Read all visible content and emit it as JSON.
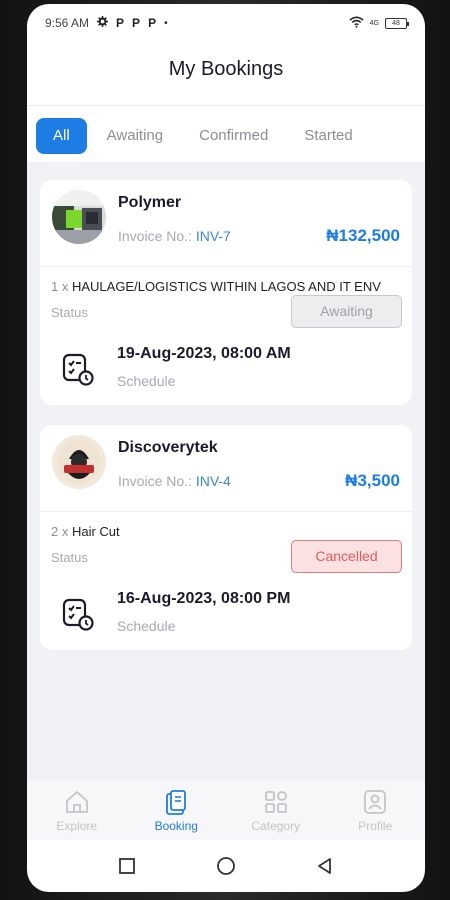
{
  "status_bar": {
    "time": "9:56 AM",
    "indicators": [
      "P",
      "P",
      "P"
    ],
    "dot": "•",
    "network": "4G",
    "battery": "48"
  },
  "header": {
    "title": "My Bookings"
  },
  "tabs": [
    {
      "label": "All",
      "active": true
    },
    {
      "label": "Awaiting",
      "active": false
    },
    {
      "label": "Confirmed",
      "active": false
    },
    {
      "label": "Started",
      "active": false
    }
  ],
  "bookings": [
    {
      "provider": "Polymer",
      "invoice_label": "Invoice No.:",
      "invoice_no": "INV-7",
      "price": "₦132,500",
      "qty": "1 x",
      "item": "HAULAGE/LOGISTICS WITHIN LAGOS AND IT ENV",
      "status_label": "Status",
      "status": "Awaiting",
      "schedule_date": "19-Aug-2023, 08:00 AM",
      "schedule_label": "Schedule"
    },
    {
      "provider": "Discoverytek",
      "invoice_label": "Invoice No.:",
      "invoice_no": "INV-4",
      "price": "₦3,500",
      "qty": "2 x",
      "item": "Hair Cut",
      "status_label": "Status",
      "status": "Cancelled",
      "schedule_date": "16-Aug-2023, 08:00 PM",
      "schedule_label": "Schedule"
    }
  ],
  "bottom_nav": [
    {
      "label": "Explore",
      "icon": "home-icon",
      "active": false
    },
    {
      "label": "Booking",
      "icon": "booking-icon",
      "active": true
    },
    {
      "label": "Category",
      "icon": "category-icon",
      "active": false
    },
    {
      "label": "Profile",
      "icon": "profile-icon",
      "active": false
    }
  ],
  "colors": {
    "accent": "#1e7de4",
    "awaiting_bg": "#ededef",
    "cancelled_bg": "#fbe1e1",
    "cancelled_text": "#e25a5a"
  }
}
